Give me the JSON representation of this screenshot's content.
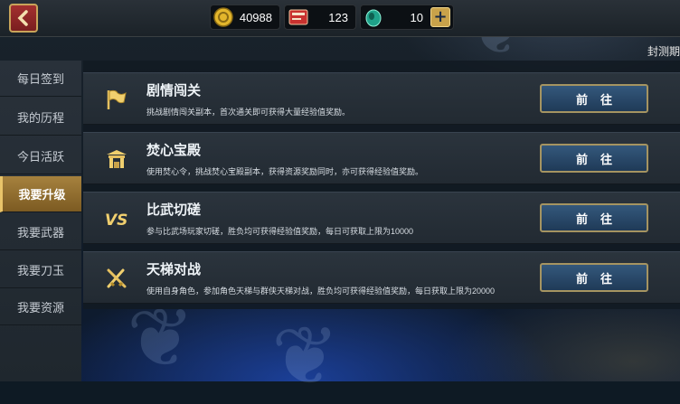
{
  "resources": {
    "coins": "40988",
    "tickets": "123",
    "jade": "10"
  },
  "header": {
    "close_tab_label": "封测期"
  },
  "sidebar": {
    "items": [
      {
        "label": "每日签到"
      },
      {
        "label": "我的历程"
      },
      {
        "label": "今日活跃"
      },
      {
        "label": "我要升级"
      },
      {
        "label": "我要武器"
      },
      {
        "label": "我要刀玉"
      },
      {
        "label": "我要资源"
      }
    ],
    "active_index": 3
  },
  "tasks": [
    {
      "title": "剧情闯关",
      "desc": "挑战剧情闯关副本，首次通关即可获得大量经验值奖励。",
      "button": "前往",
      "icon": "flag-icon"
    },
    {
      "title": "焚心宝殿",
      "desc": "使用焚心令，挑战焚心宝殿副本，获得资源奖励同时，亦可获得经验值奖励。",
      "button": "前往",
      "icon": "gate-icon"
    },
    {
      "title": "比武切磋",
      "desc": "参与比武场玩家切磋，胜负均可获得经验值奖励，每日可获取上限为10000",
      "button": "前往",
      "icon": "vs-icon"
    },
    {
      "title": "天梯对战",
      "desc": "使用自身角色，参加角色天梯与群侠天梯对战，胜负均可获得经验值奖励，每日获取上限为20000",
      "button": "前往",
      "icon": "crossed-swords-icon"
    }
  ],
  "colors": {
    "accent_gold": "#c9a24a",
    "active_tab": "#a6823e",
    "button_blue": "#2a4b6d"
  }
}
